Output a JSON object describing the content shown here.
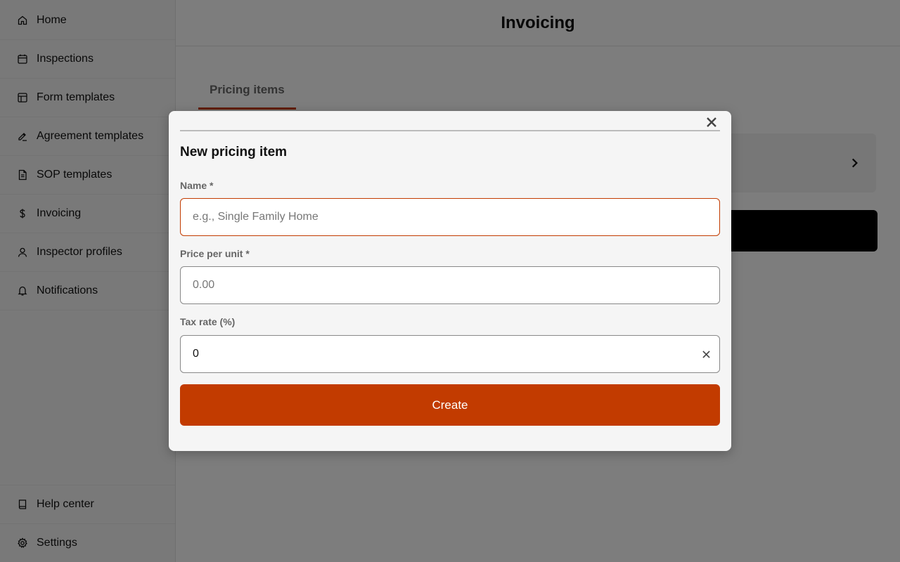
{
  "sidebar": {
    "items": [
      {
        "label": "Home",
        "icon": "home-icon"
      },
      {
        "label": "Inspections",
        "icon": "calendar-icon"
      },
      {
        "label": "Form templates",
        "icon": "layout-icon"
      },
      {
        "label": "Agreement templates",
        "icon": "signature-icon"
      },
      {
        "label": "SOP templates",
        "icon": "document-icon"
      },
      {
        "label": "Invoicing",
        "icon": "dollar-icon"
      },
      {
        "label": "Inspector profiles",
        "icon": "user-icon"
      },
      {
        "label": "Notifications",
        "icon": "bell-icon"
      }
    ],
    "bottom_items": [
      {
        "label": "Help center",
        "icon": "book-icon"
      },
      {
        "label": "Settings",
        "icon": "gear-icon"
      }
    ]
  },
  "header": {
    "title": "Invoicing"
  },
  "tabs": [
    {
      "label": "Pricing items"
    }
  ],
  "modal": {
    "title": "New pricing item",
    "name_label": "Name *",
    "name_placeholder": "e.g., Single Family Home",
    "name_value": "",
    "price_label": "Price per unit *",
    "price_placeholder": "0.00",
    "price_value": "",
    "tax_label": "Tax rate (%)",
    "tax_value": "0",
    "create_label": "Create"
  },
  "colors": {
    "accent": "#c23b00",
    "overlay": "rgba(0,0,0,0.5)"
  }
}
